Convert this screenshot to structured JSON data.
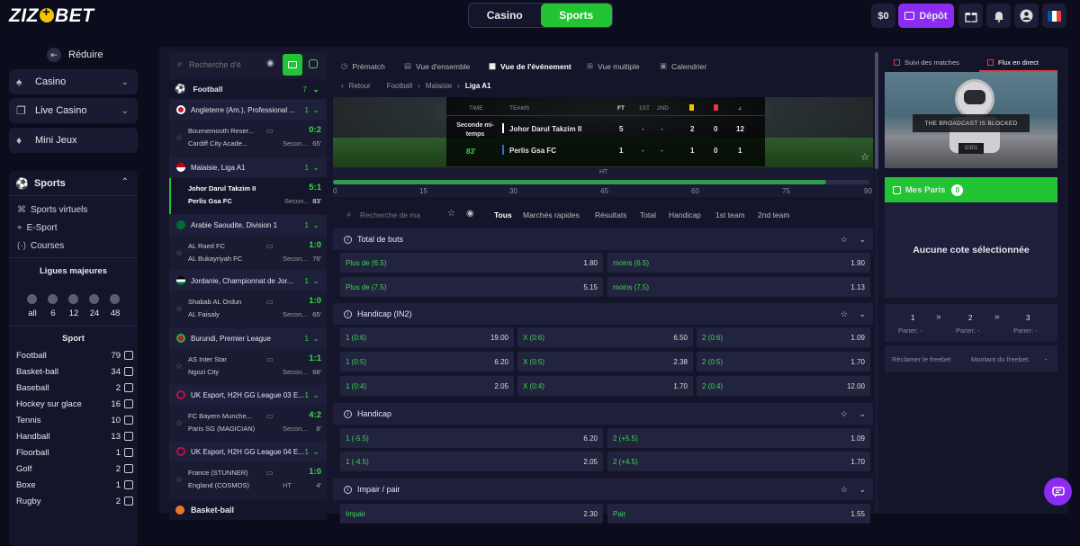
{
  "header": {
    "logo": "ZIZOBET",
    "tabs": [
      "Casino",
      "Sports"
    ],
    "active_tab": "Sports",
    "balance": "$0",
    "deposit_label": "Dépôt",
    "colors": {
      "accent": "#22c434",
      "deposit": "#8b2cf0",
      "background": "#0b0c1c"
    }
  },
  "sidebar": {
    "collapse_label": "Réduire",
    "nav": [
      {
        "label": "Casino",
        "icon": "spade-icon"
      },
      {
        "label": "Live Casino",
        "icon": "cards-icon"
      },
      {
        "label": "Mini Jeux",
        "icon": "diamond-icon"
      }
    ],
    "sports_label": "Sports",
    "sports_sub": [
      "Sports virtuels",
      "E-Sport",
      "Courses"
    ],
    "leagues_title": "Ligues majeures",
    "hour_filters": [
      "all",
      "6",
      "12",
      "24",
      "48"
    ],
    "sport_title": "Sport",
    "sports": [
      {
        "name": "Football",
        "count": "79"
      },
      {
        "name": "Basket-ball",
        "count": "34"
      },
      {
        "name": "Baseball",
        "count": "2"
      },
      {
        "name": "Hockey sur glace",
        "count": "16"
      },
      {
        "name": "Tennis",
        "count": "10"
      },
      {
        "name": "Handball",
        "count": "13"
      },
      {
        "name": "Floorball",
        "count": "1"
      },
      {
        "name": "Golf",
        "count": "2"
      },
      {
        "name": "Boxe",
        "count": "1"
      },
      {
        "name": "Rugby",
        "count": "2"
      }
    ]
  },
  "events": {
    "search_placeholder": "Recherche d'é",
    "sport": {
      "name": "Football",
      "count": "7"
    },
    "groups": [
      {
        "league": "Angleterre (Am.), Professional ...",
        "count": "1",
        "flag": "#cf142b",
        "match": {
          "t1": "Bournemouth Reser...",
          "t2": "Cardiff City Acade...",
          "s1": "0:2",
          "status": "Secon...",
          "minute": "65'"
        }
      },
      {
        "league": "Malaisie, Liga A1",
        "count": "1",
        "flag": "#cc0001",
        "match": {
          "t1": "Johor Darul Takzim II",
          "t2": "Perlis Gsa FC",
          "s1": "5:1",
          "status": "Secon...",
          "minute": "83'"
        }
      },
      {
        "league": "Arabie Saoudite, Division 1",
        "count": "1",
        "flag": "#006c35",
        "match": {
          "t1": "AL Raed FC",
          "t2": "AL Bukayriyah FC",
          "s1": "1:0",
          "status": "Secon...",
          "minute": "76'"
        }
      },
      {
        "league": "Jordanie, Championnat de Jor...",
        "count": "1",
        "flag": "#007a3d",
        "match": {
          "t1": "Shabab AL Ordun",
          "t2": "AL Faisaly",
          "s1": "1:0",
          "status": "Secon...",
          "minute": "65'"
        }
      },
      {
        "league": "Burundi, Premier League",
        "count": "1",
        "flag": "#ce1126",
        "match": {
          "t1": "AS Inter Star",
          "t2": "Ngozi City",
          "s1": "1:1",
          "status": "Secon...",
          "minute": "68'"
        }
      },
      {
        "league": "UK Esport, H2H GG League 03 E...",
        "count": "1",
        "flag": "#012169",
        "match": {
          "t1": "FC Bayern Munche...",
          "t2": "Paris SG (MAGICIAN)",
          "s1": "4:2",
          "status": "Secon...",
          "minute": "8'"
        }
      },
      {
        "league": "UK Esport, H2H GG League 04 E...",
        "count": "1",
        "flag": "#012169",
        "match": {
          "t1": "France (STUNNER)",
          "t2": "England (COSMOS)",
          "s1": "1:0",
          "status": "HT",
          "minute": "4'"
        }
      }
    ],
    "next_sport": "Basket-ball"
  },
  "center": {
    "tabs": [
      "Prématch",
      "Vue d'ensemble",
      "Vue de l'événement",
      "Vue multiple",
      "Calendrier"
    ],
    "breadcrumb": {
      "back": "Retour",
      "items": [
        "Football",
        "Malaisie",
        "Liga A1"
      ]
    },
    "scoreboard": {
      "time_label": "TIME",
      "teams_label": "TEAMS",
      "cols": [
        "FT",
        "1ST",
        "2ND"
      ],
      "period": "Seconde mi-temps",
      "minute": "83'",
      "rows": [
        {
          "team": "Johor Darul Takzim II",
          "ft": "5",
          "first": "-",
          "second": "-",
          "yc": "2",
          "rc": "0",
          "corners": "12"
        },
        {
          "team": "Perlis Gsa FC",
          "ft": "1",
          "first": "-",
          "second": "-",
          "yc": "1",
          "rc": "0",
          "corners": "1"
        }
      ]
    },
    "timeline": {
      "ht_label": "HT",
      "ticks": [
        "0",
        "15",
        "30",
        "45",
        "60",
        "75",
        "90"
      ],
      "progress": 0.92
    },
    "market_search_placeholder": "Recherche de ma",
    "market_tabs": [
      "Tous",
      "Marchés rapides",
      "Résultats",
      "Total",
      "Handicap",
      "1st team",
      "2nd team"
    ],
    "markets": [
      {
        "title": "Total de buts",
        "rows": [
          [
            {
              "l": "Plus de (6.5)",
              "v": "1.80"
            },
            {
              "l": "moins (6.5)",
              "v": "1.90"
            }
          ],
          [
            {
              "l": "Plus de (7.5)",
              "v": "5.15"
            },
            {
              "l": "moins (7.5)",
              "v": "1.13"
            }
          ]
        ]
      },
      {
        "title": "Handicap (IN2)",
        "rows": [
          [
            {
              "l": "1 (0:6)",
              "v": "19.00"
            },
            {
              "l": "X (0:6)",
              "v": "6.50"
            },
            {
              "l": "2 (0:6)",
              "v": "1.09"
            }
          ],
          [
            {
              "l": "1 (0:5)",
              "v": "6.20"
            },
            {
              "l": "X (0:5)",
              "v": "2.38"
            },
            {
              "l": "2 (0:5)",
              "v": "1.70"
            }
          ],
          [
            {
              "l": "1 (0:4)",
              "v": "2.05"
            },
            {
              "l": "X (0:4)",
              "v": "1.70"
            },
            {
              "l": "2 (0:4)",
              "v": "12.00"
            }
          ]
        ]
      },
      {
        "title": "Handicap",
        "rows": [
          [
            {
              "l": "1 (-5.5)",
              "v": "6.20"
            },
            {
              "l": "2 (+5.5)",
              "v": "1.09"
            }
          ],
          [
            {
              "l": "1 (-4.5)",
              "v": "2.05"
            },
            {
              "l": "2 (+4.5)",
              "v": "1.70"
            }
          ]
        ]
      },
      {
        "title": "Impair / pair",
        "rows": [
          [
            {
              "l": "Impair",
              "v": "2.30"
            },
            {
              "l": "Pair",
              "v": "1.55"
            }
          ]
        ]
      }
    ]
  },
  "right": {
    "tabs": [
      "Suivi des matches",
      "Flux en direct"
    ],
    "stream_text": "THE BROADCAST IS BLOCKED",
    "stream_code": "G301",
    "mes_paris": "Mes Paris",
    "mes_paris_count": "0",
    "empty_text": "Aucune cote sélectionnée",
    "steps": [
      "1",
      "2",
      "3"
    ],
    "parier": [
      "Parier: -",
      "Parier: -",
      "Parier: -"
    ],
    "claim": "Réclamer le freebet",
    "amount": "Montant du freebet:",
    "amount_value": "-"
  }
}
